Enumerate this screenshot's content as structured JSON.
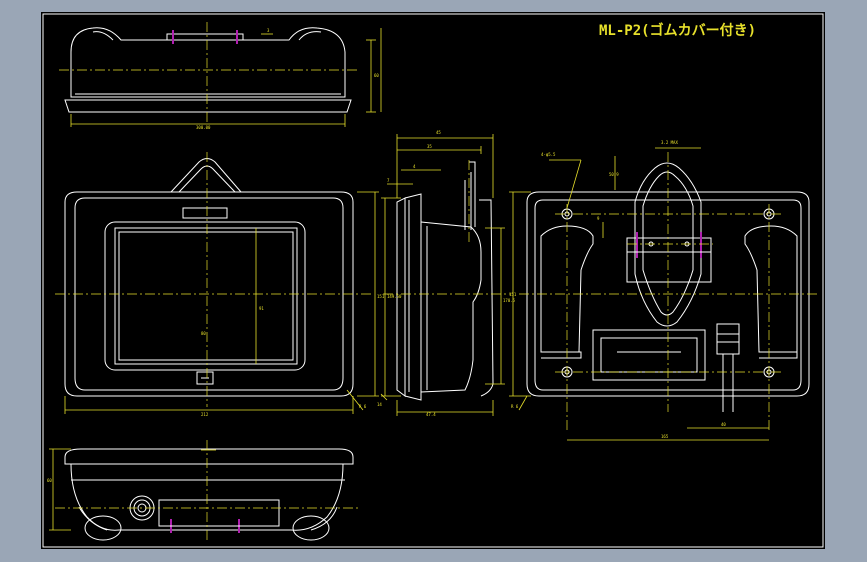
{
  "drawing": {
    "title": "ML-P2(ゴムカバー付き)",
    "colors": {
      "background": "#000000",
      "frame": "#9aa6b6",
      "outline": "#ffffff",
      "dimension": "#e7e02b",
      "centerline": "#e7e02b",
      "accent": "#b020b0",
      "title": "#e7e02b"
    }
  }
}
